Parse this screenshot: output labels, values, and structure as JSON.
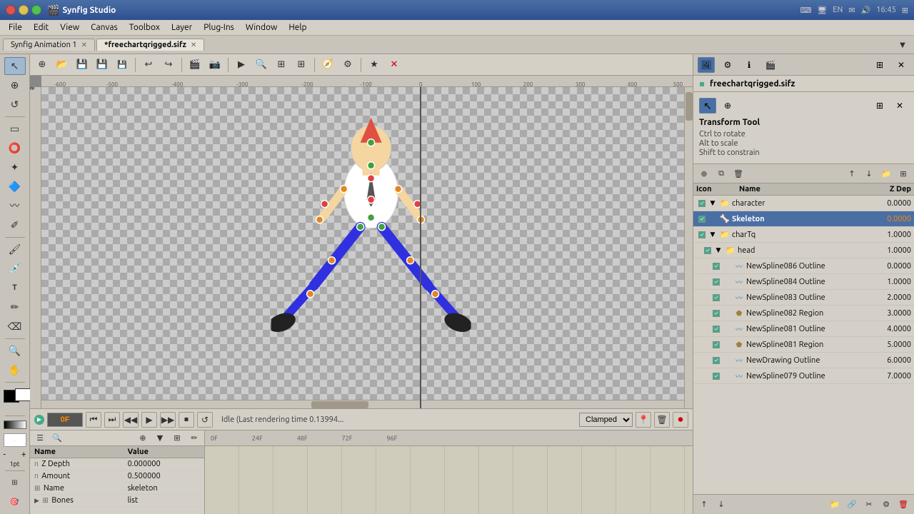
{
  "app": {
    "title": "Synfig Studio",
    "icon": "🎬"
  },
  "titlebar": {
    "title": "Synfig Studio",
    "time": "16:45",
    "buttons": {
      "close": "✕",
      "minimize": "−",
      "maximize": "□"
    }
  },
  "menubar": {
    "items": [
      "File",
      "Edit",
      "View",
      "Canvas",
      "Toolbox",
      "Layer",
      "Plug-Ins",
      "Window",
      "Help"
    ]
  },
  "tabs": [
    {
      "label": "Synfig Animation 1",
      "active": false,
      "closable": true
    },
    {
      "label": "*freechartqrigged.sifz",
      "active": true,
      "closable": true
    }
  ],
  "toolbar": {
    "tools": [
      "↩",
      "↪",
      "⬛",
      "▶",
      "💾",
      "⟳",
      "⟲",
      "🎬",
      "📷",
      "⊕",
      "⊖",
      "⟳",
      "⊞",
      "🔧",
      "★",
      "✕"
    ]
  },
  "left_tools": {
    "tools": [
      "↖",
      "⊕",
      "⬜",
      "⭕",
      "▭",
      "✦",
      "🔷",
      "✂",
      "✏",
      "🖌",
      "T",
      "🔺",
      "📐",
      "🖊",
      "🔍",
      "💡",
      "🌐",
      "⊞",
      "🎯",
      "⬛"
    ]
  },
  "canvas": {
    "title": "freechartqrigged.sifz",
    "ruler_marks": [
      "-600",
      "-500",
      "-400",
      "-300",
      "-200",
      "-100",
      "0",
      "100",
      "200",
      "300",
      "400",
      "500"
    ]
  },
  "tool_info": {
    "name": "Transform Tool",
    "hints": [
      "Ctrl to rotate",
      "Alt to scale",
      "Shift to constrain"
    ]
  },
  "playback": {
    "frame": "0F",
    "status": "Idle (Last rendering time 0.13994...",
    "interpolation": "Clamped",
    "buttons": [
      "⏮",
      "⏭",
      "◀◀",
      "▶",
      "▶▶",
      "⏹",
      "⏭"
    ]
  },
  "params": {
    "columns": [
      "Name",
      "Value"
    ],
    "rows": [
      {
        "icon": "π",
        "expand": false,
        "name": "Z Depth",
        "value": "0.000000"
      },
      {
        "icon": "π",
        "expand": false,
        "name": "Amount",
        "value": "0.500000"
      },
      {
        "icon": "⊞",
        "expand": false,
        "name": "Name",
        "value": "skeleton"
      },
      {
        "icon": "▶",
        "expand": true,
        "name": "Bones",
        "value": "list"
      }
    ]
  },
  "layers": {
    "columns": {
      "icon": "Icon",
      "name": "Name",
      "zdepth": "Z Dep"
    },
    "rows": [
      {
        "checked": true,
        "expand": true,
        "icon": "📁",
        "name": "character",
        "zdepth": "0.0000",
        "selected": false,
        "indent": 0
      },
      {
        "checked": true,
        "expand": false,
        "icon": "🦴",
        "name": "Skeleton",
        "zdepth": "0.0000",
        "selected": true,
        "indent": 1
      },
      {
        "checked": true,
        "expand": true,
        "icon": "📁",
        "name": "charTq",
        "zdepth": "1.0000",
        "selected": false,
        "indent": 1
      },
      {
        "checked": true,
        "expand": true,
        "icon": "📁",
        "name": "head",
        "zdepth": "1.0000",
        "selected": false,
        "indent": 2
      },
      {
        "checked": true,
        "expand": false,
        "icon": "〰",
        "name": "NewSpline086 Outline",
        "zdepth": "0.0000",
        "selected": false,
        "indent": 3
      },
      {
        "checked": true,
        "expand": false,
        "icon": "〰",
        "name": "NewSpline084 Outline",
        "zdepth": "1.0000",
        "selected": false,
        "indent": 3
      },
      {
        "checked": true,
        "expand": false,
        "icon": "〰",
        "name": "NewSpline083 Outline",
        "zdepth": "2.0000",
        "selected": false,
        "indent": 3
      },
      {
        "checked": true,
        "expand": false,
        "icon": "⬟",
        "name": "NewSpline082 Region",
        "zdepth": "3.0000",
        "selected": false,
        "indent": 3
      },
      {
        "checked": true,
        "expand": false,
        "icon": "〰",
        "name": "NewSpline081 Outline",
        "zdepth": "4.0000",
        "selected": false,
        "indent": 3
      },
      {
        "checked": true,
        "expand": false,
        "icon": "⬟",
        "name": "NewSpline081 Region",
        "zdepth": "5.0000",
        "selected": false,
        "indent": 3
      },
      {
        "checked": true,
        "expand": false,
        "icon": "〰",
        "name": "NewDrawing Outline",
        "zdepth": "6.0000",
        "selected": false,
        "indent": 3
      },
      {
        "checked": true,
        "expand": false,
        "icon": "〰",
        "name": "NewSpline079 Outline",
        "zdepth": "7.0000",
        "selected": false,
        "indent": 3
      }
    ]
  },
  "timeline": {
    "marks": [
      "0F",
      "24F",
      "48F",
      "72F",
      "96F"
    ]
  },
  "colors": {
    "selected_layer_bg": "#4a6fa5",
    "selected_layer_text": "#ffffff",
    "accent_orange": "#ff8800"
  }
}
